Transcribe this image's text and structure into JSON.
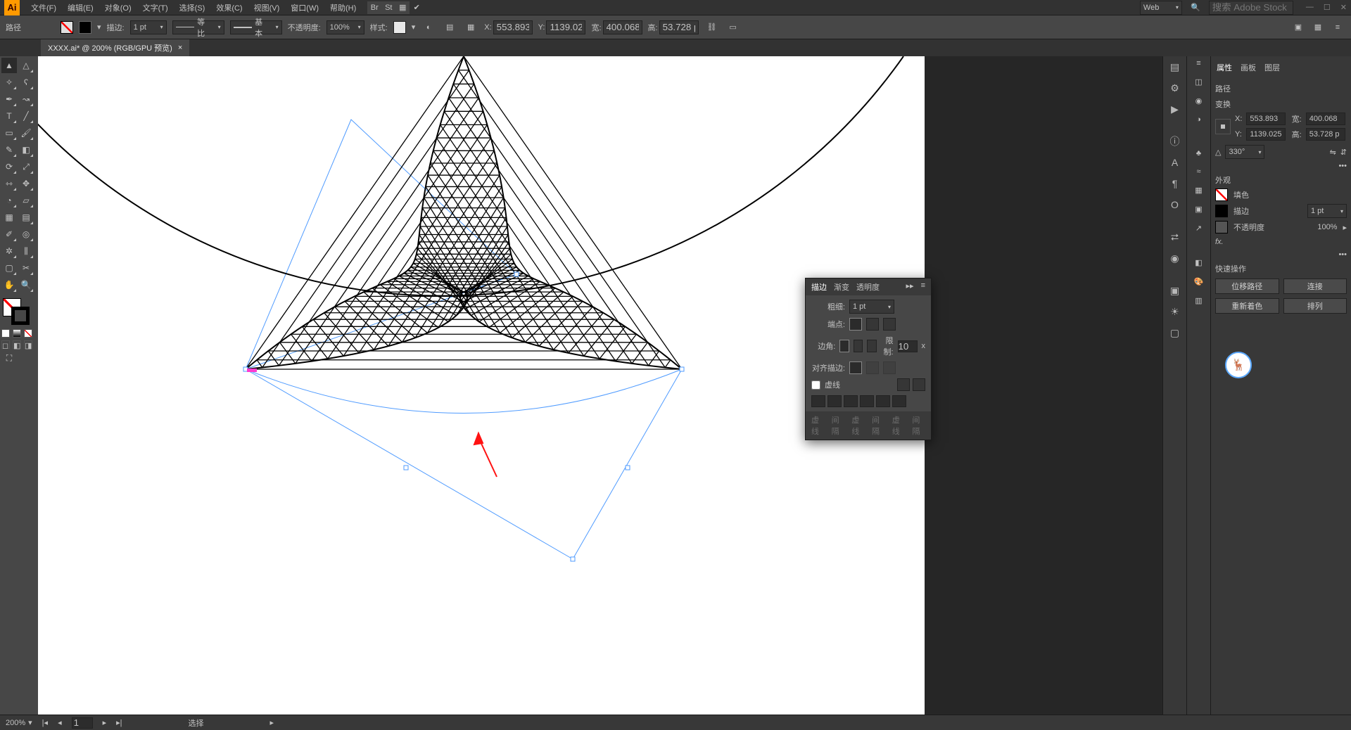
{
  "app_logo_text": "Ai",
  "menus": {
    "file": "文件(F)",
    "edit": "编辑(E)",
    "object": "对象(O)",
    "type": "文字(T)",
    "select": "选择(S)",
    "effect": "效果(C)",
    "view": "视图(V)",
    "window": "窗口(W)",
    "help": "帮助(H)"
  },
  "workspace_label": "Web",
  "search_placeholder": "搜索 Adobe Stock",
  "ctrl": {
    "path_label": "路径",
    "stroke_label": "描边:",
    "stroke_weight": "1 pt",
    "dash_style": "等比",
    "profile": "基本",
    "opacity_label": "不透明度:",
    "opacity": "100%",
    "style_label": "样式:",
    "x_label": "X:",
    "x": "553.893",
    "y_label": "Y:",
    "y": "1139.025",
    "w_label": "宽:",
    "w": "400.068",
    "h_label": "高:",
    "h": "53.728 p"
  },
  "document": {
    "name": "XXXX.ai* @ 200% (RGB/GPU 预览)",
    "close": "×"
  },
  "props": {
    "tabs": {
      "properties": "属性",
      "artboards": "画板",
      "layers": "图层"
    },
    "sel_label": "路径",
    "transform_label": "变换",
    "x": "553.893",
    "y": "1139.025",
    "w": "400.068",
    "h": "53.728 p",
    "angle": "330°",
    "appearance_label": "外观",
    "fill_label": "填色",
    "stroke_label": "描边",
    "stroke_weight": "1 pt",
    "opacity_label": "不透明度",
    "opacity": "100%",
    "fx_label": "fx.",
    "quick_label": "快速操作",
    "btn_offset": "位移路径",
    "btn_join": "连接",
    "btn_recolor": "重新着色",
    "btn_arrange": "排列"
  },
  "float": {
    "tabs": {
      "stroke": "描边",
      "grad": "渐变",
      "trans": "透明度"
    },
    "weight_label": "粗细:",
    "weight": "1 pt",
    "cap_label": "端点:",
    "corner_label": "边角:",
    "limit_label": "限制:",
    "limit": "10",
    "x": "x",
    "align_label": "对齐描边:",
    "dash_label": "虚线",
    "ft": {
      "a": "虚线",
      "b": "间隔",
      "c": "虚线",
      "d": "间隔",
      "e": "虚线",
      "f": "间隔"
    }
  },
  "status": {
    "zoom": "200%",
    "art_idx": "1",
    "tool": "选择"
  }
}
